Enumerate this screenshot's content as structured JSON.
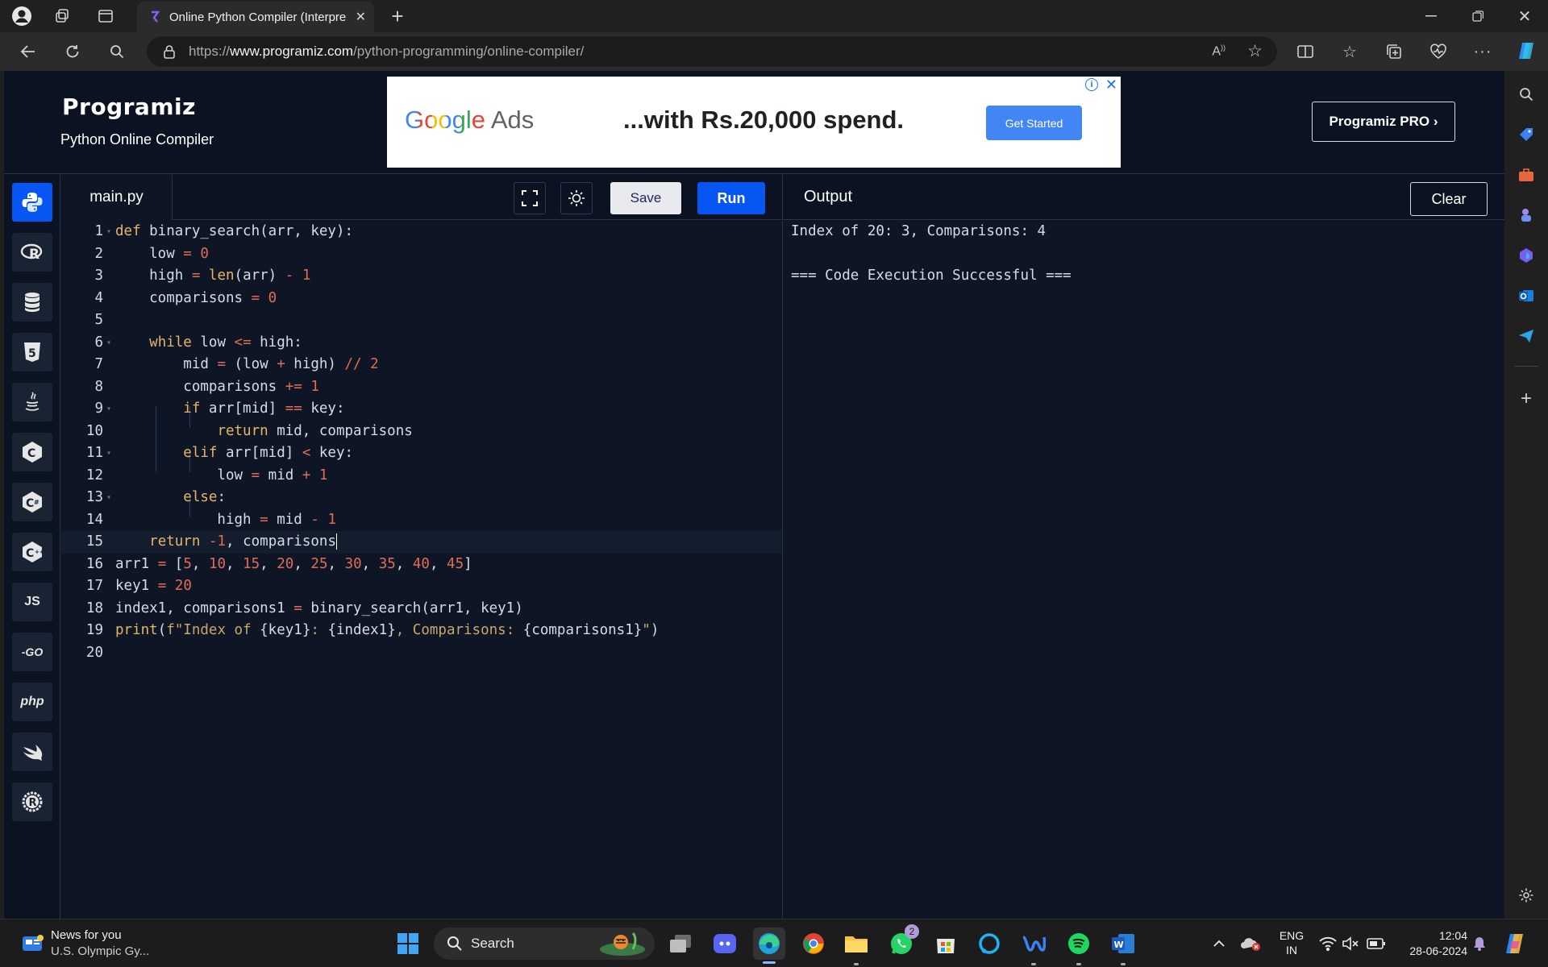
{
  "browser": {
    "tab_title": "Online Python Compiler (Interpre",
    "url_prefix": "https://",
    "url_domain": "www.programiz.com",
    "url_path": "/python-programming/online-compiler/"
  },
  "site": {
    "logo": "Programiz",
    "subtitle": "Python Online Compiler",
    "pro_button": "Programiz PRO ›"
  },
  "ad": {
    "brand_google": "Google",
    "brand_ads": "Ads",
    "copy": "...with Rs.20,000 spend.",
    "cta": "Get Started",
    "info": "i",
    "close": "✕"
  },
  "rail": {
    "languages": [
      {
        "name": "python",
        "label": ""
      },
      {
        "name": "r",
        "label": "R"
      },
      {
        "name": "sql",
        "label": ""
      },
      {
        "name": "html",
        "label": "5"
      },
      {
        "name": "java",
        "label": ""
      },
      {
        "name": "c",
        "label": "C"
      },
      {
        "name": "csharp",
        "label": "C"
      },
      {
        "name": "cpp",
        "label": "C"
      },
      {
        "name": "js",
        "label": "JS"
      },
      {
        "name": "go",
        "label": "-GO"
      },
      {
        "name": "php",
        "label": "php"
      },
      {
        "name": "swift",
        "label": ""
      },
      {
        "name": "rust",
        "label": "R"
      }
    ]
  },
  "editor": {
    "file_tab": "main.py",
    "save_label": "Save",
    "run_label": "Run",
    "line_numbers": [
      "1",
      "2",
      "3",
      "4",
      "5",
      "6",
      "7",
      "8",
      "9",
      "10",
      "11",
      "12",
      "13",
      "14",
      "15",
      "16",
      "17",
      "18",
      "19",
      "20"
    ]
  },
  "output": {
    "title": "Output",
    "clear_label": "Clear",
    "lines": [
      "Index of 20: 3, Comparisons: 4",
      "",
      "=== Code Execution Successful ==="
    ]
  },
  "taskbar": {
    "news_title": "News for you",
    "news_sub": "U.S. Olympic Gy...",
    "search_label": "Search",
    "whatsapp_badge": "2",
    "lang_top": "ENG",
    "lang_bottom": "IN",
    "time": "12:04",
    "date": "28-06-2024"
  },
  "colors": {
    "page_bg": "#0e1626",
    "header_bg": "#0b1221",
    "accent_blue": "#0556f3",
    "keyword": "#e5b567",
    "number": "#e06c56"
  }
}
